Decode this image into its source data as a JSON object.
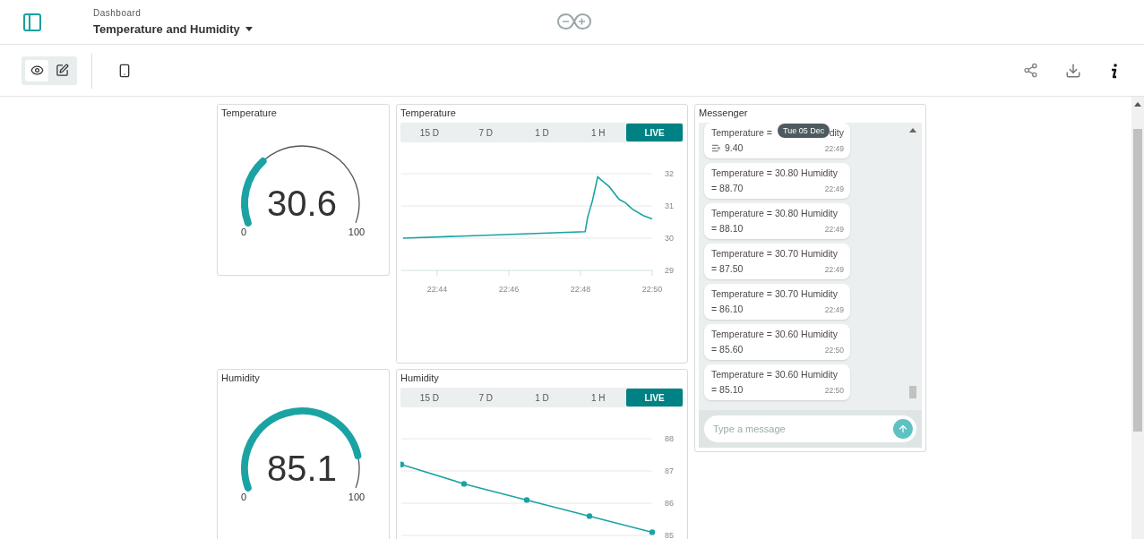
{
  "header": {
    "breadcrumb": "Dashboard",
    "title": "Temperature and Humidity"
  },
  "toolbar": {
    "modes": [
      {
        "kind": "view",
        "selected": true
      },
      {
        "kind": "edit",
        "selected": false
      }
    ]
  },
  "gauges": [
    {
      "title": "Temperature",
      "value": "30.6",
      "min": "0",
      "max": "100"
    },
    {
      "title": "Humidity",
      "value": "85.1",
      "min": "0",
      "max": "100"
    }
  ],
  "charts": [
    {
      "title": "Temperature",
      "ranges": [
        {
          "label": "15 D",
          "selected": false
        },
        {
          "label": "7 D",
          "selected": false
        },
        {
          "label": "1 D",
          "selected": false
        },
        {
          "label": "1 H",
          "selected": false
        },
        {
          "label": "LIVE",
          "selected": true
        }
      ],
      "chart_data": {
        "type": "line",
        "x": [
          1363.05,
          1368.13,
          1368.2,
          1368.33,
          1368.48,
          1368.58,
          1368.8,
          1369.08,
          1369.25,
          1369.45,
          1369.75,
          1370.0
        ],
        "series": [
          {
            "color": "#1ba3a3",
            "values": [
              30.0,
              30.2,
              30.65,
              31.15,
              31.9,
              31.8,
              31.6,
              31.2,
              31.1,
              30.9,
              30.7,
              30.6
            ]
          }
        ],
        "xlim": [
          1363,
          1370
        ],
        "ylim": [
          29,
          32
        ],
        "yticks": [
          29,
          30,
          31,
          32
        ],
        "xticks": [
          {
            "value": 1364,
            "label": "22:44"
          },
          {
            "value": 1366,
            "label": "22:46"
          },
          {
            "value": 1368,
            "label": "22:48"
          },
          {
            "value": 1370,
            "label": "22:50"
          }
        ]
      }
    },
    {
      "title": "Humidity",
      "ranges": [
        {
          "label": "15 D",
          "selected": false
        },
        {
          "label": "7 D",
          "selected": false
        },
        {
          "label": "1 D",
          "selected": false
        },
        {
          "label": "1 H",
          "selected": false
        },
        {
          "label": "LIVE",
          "selected": true
        }
      ],
      "chart_data": {
        "type": "line",
        "categories": [
          null,
          null,
          null,
          null,
          null
        ],
        "series": [
          {
            "color": "#1ba3a3",
            "marker": "circle",
            "values": [
              87.2,
              86.6,
              86.1,
              85.6,
              85.1
            ]
          }
        ],
        "ylim": [
          85,
          88
        ],
        "yticks": [
          85,
          86,
          87,
          88
        ]
      }
    }
  ],
  "messenger": {
    "title": "Messenger",
    "date_tooltip": "Tue 05 Dec",
    "placeholder": "Type a message",
    "messages": [
      {
        "kind": "partial",
        "visible_start": "Temperature =",
        "visible_end": "dity",
        "second_line": "9.40",
        "time": "22:49"
      },
      {
        "kind": "full",
        "line_1": "Temperature = 30.80 Humidity",
        "line_2": "= 88.70",
        "time": "22:49"
      },
      {
        "kind": "full",
        "line_1": "Temperature = 30.80 Humidity",
        "line_2": "= 88.10",
        "time": "22:49"
      },
      {
        "kind": "full",
        "line_1": "Temperature = 30.70 Humidity",
        "line_2": "= 87.50",
        "time": "22:49"
      },
      {
        "kind": "full",
        "line_1": "Temperature = 30.70 Humidity",
        "line_2": "= 86.10",
        "time": "22:49"
      },
      {
        "kind": "full",
        "line_1": "Temperature = 30.60 Humidity",
        "line_2": "= 85.60",
        "time": "22:50"
      },
      {
        "kind": "full",
        "line_1": "Temperature = 30.60 Humidity",
        "line_2": "= 85.10",
        "time": "22:50"
      }
    ]
  }
}
